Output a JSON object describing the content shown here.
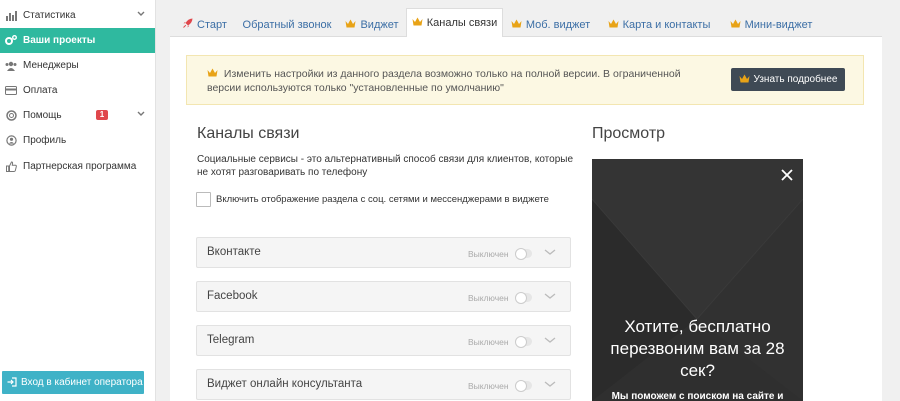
{
  "sidebar": {
    "items": [
      {
        "label": "Статистика",
        "icon": "bar-chart-icon"
      },
      {
        "label": "Ваши проекты",
        "icon": "cogs-icon"
      },
      {
        "label": "Менеджеры",
        "icon": "users-icon"
      },
      {
        "label": "Оплата",
        "icon": "credit-card-icon"
      },
      {
        "label": "Помощь",
        "icon": "lifebuoy-icon",
        "badge": "1"
      },
      {
        "label": "Профиль",
        "icon": "user-icon"
      },
      {
        "label": "Партнерская программа",
        "icon": "thumbs-up-icon"
      }
    ],
    "operator_button": "Вход в кабинет оператора"
  },
  "tabs": [
    {
      "label": "Старт",
      "icon": "rocket-icon"
    },
    {
      "label": "Обратный звонок"
    },
    {
      "label": "Виджет",
      "icon": "crown-icon"
    },
    {
      "label": "Каналы связи",
      "icon": "crown-icon",
      "active": true
    },
    {
      "label": "Моб. виджет",
      "icon": "crown-icon"
    },
    {
      "label": "Карта и контакты",
      "icon": "crown-icon"
    },
    {
      "label": "Мини-виджет",
      "icon": "crown-icon"
    }
  ],
  "notice": {
    "text": "Изменить настройки из данного раздела возможно только на полной версии. В ограниченной версии используются только \"установленные по умолчанию\"",
    "button": "Узнать подробнее"
  },
  "channels": {
    "title": "Каналы связи",
    "description": "Социальные сервисы - это альтернативный способ связи для клиентов, которые не хотят разговаривать по телефону",
    "checkbox_label": "Включить отображение раздела с соц. сетями и мессенджерами в виджете",
    "items": [
      {
        "name": "Вконтакте",
        "state": "Выключен"
      },
      {
        "name": "Facebook",
        "state": "Выключен"
      },
      {
        "name": "Telegram",
        "state": "Выключен"
      },
      {
        "name": "Виджет онлайн консультанта",
        "state": "Выключен"
      }
    ]
  },
  "preview": {
    "title": "Просмотр",
    "headline": "Хотите, бесплатно перезвоним вам за 28 сек?",
    "subtext": "Мы поможем с поиском на сайте и"
  },
  "colors": {
    "active_nav": "#2fb99f",
    "operator_button": "#3fb2c7",
    "notice_bg": "#fcf8e3",
    "crown": "#e8a317",
    "preview_bg": "#2f2f2f"
  }
}
